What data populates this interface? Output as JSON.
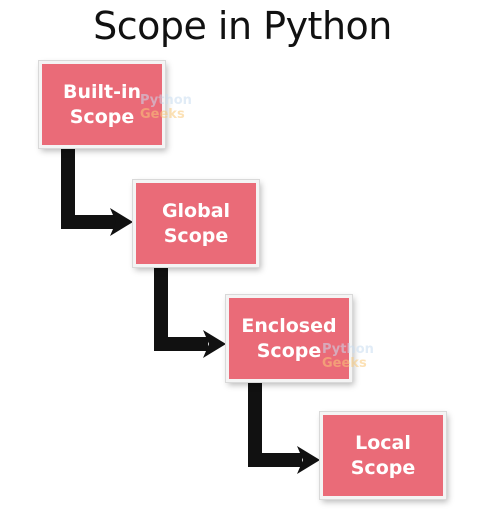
{
  "title": "Scope in Python",
  "boxes": [
    {
      "line1": "Built-in",
      "line2": "Scope"
    },
    {
      "line1": "Global",
      "line2": "Scope"
    },
    {
      "line1": "Enclosed",
      "line2": "Scope"
    },
    {
      "line1": "Local",
      "line2": "Scope"
    }
  ],
  "watermark": {
    "line1": "Python",
    "line2": "Geeks"
  },
  "colors": {
    "box_fill": "#ea6b78",
    "box_text": "#ffffff",
    "arrow": "#111111",
    "title_text": "#111111"
  }
}
